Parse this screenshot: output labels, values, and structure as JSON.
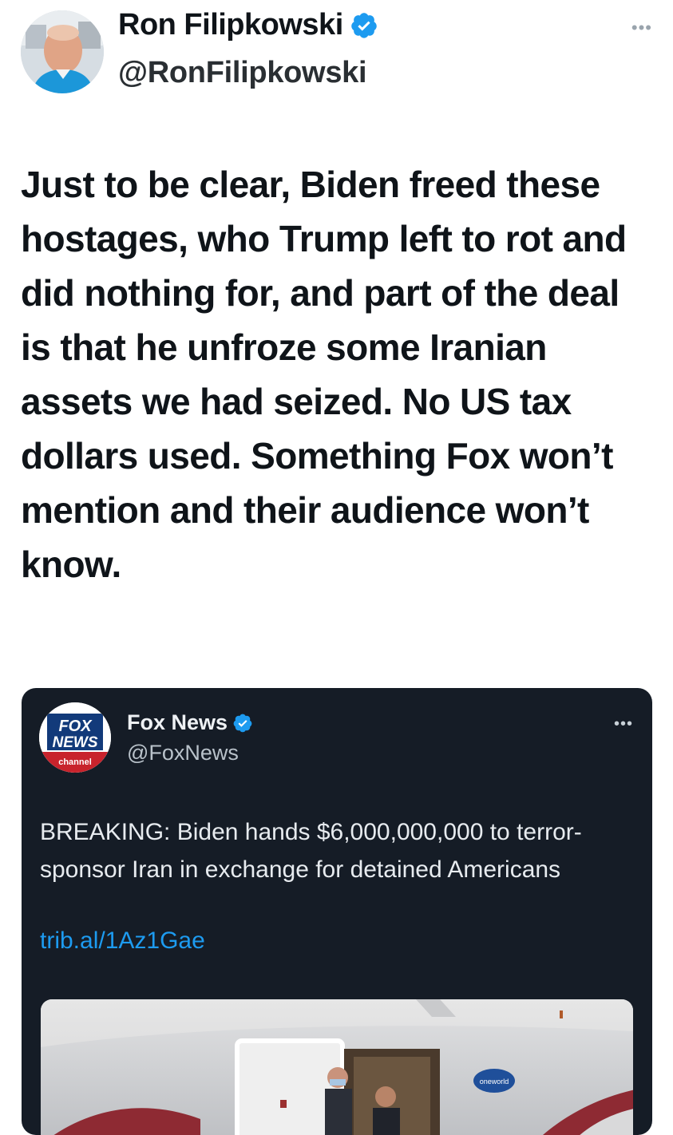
{
  "tweet": {
    "author_name": "Ron Filipkowski",
    "author_handle": "@RonFilipkowski",
    "more_label": "•••",
    "text": "Just to be clear, Biden freed these hostages, who Trump left to rot and did nothing for, and part of the deal is that he unfroze some Iranian assets we had seized. No US tax dollars used. Something Fox won’t mention and their audience won’t know.",
    "verified_color": "#1d9bf0"
  },
  "quoted_tweet": {
    "author_name": "Fox News",
    "author_handle": "@FoxNews",
    "more_label": "•••",
    "text": "BREAKING: Biden hands $6,000,000,000 to terror-sponsor Iran in exchange for detained Americans",
    "link": "trib.al/1Az1Gae",
    "logo": {
      "line1": "FOX",
      "line2": "NEWS",
      "line3": "channel"
    },
    "media": {
      "airline_badge": "oneworld"
    },
    "card_color": "#151c26",
    "link_color": "#1d9bf0"
  }
}
